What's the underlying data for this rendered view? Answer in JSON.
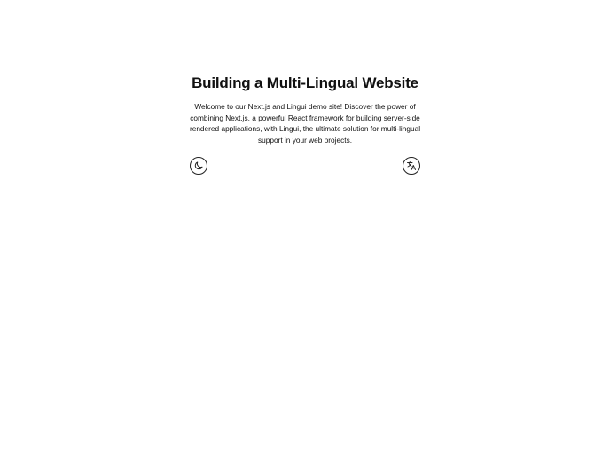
{
  "main": {
    "title": "Building a Multi-Lingual Website",
    "intro": "Welcome to our Next.js and Lingui demo site! Discover the power of combining Next.js, a powerful React framework for building server-side rendered applications, with Lingui, the ultimate solution for multi-lingual support in your web projects."
  },
  "controls": {
    "theme_toggle_icon": "moon-icon",
    "language_switcher_icon": "translate-icon"
  }
}
